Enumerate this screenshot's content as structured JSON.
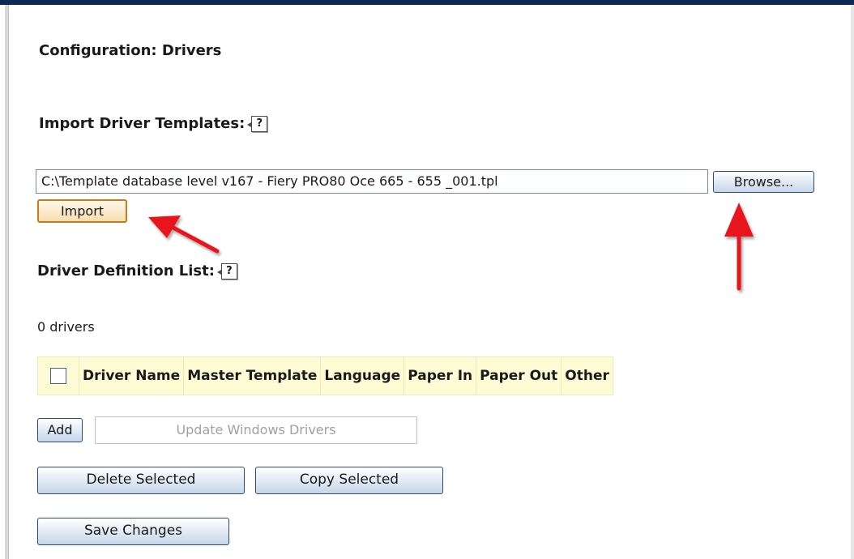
{
  "page": {
    "title": "Configuration: Drivers"
  },
  "import_section": {
    "title": "Import Driver Templates:",
    "help_icon": "help-question-icon",
    "file_path_value": "C:\\Template database level v167 - Fiery PRO80 Oce 665 - 655 _001.tpl",
    "browse_label": "Browse...",
    "import_label": "Import"
  },
  "list_section": {
    "title": "Driver Definition List:",
    "help_icon": "help-question-icon",
    "count_text": "0 drivers",
    "columns": [
      "Driver Name",
      "Master Template",
      "Language",
      "Paper In",
      "Paper Out",
      "Other"
    ]
  },
  "buttons": {
    "add": "Add",
    "update_windows_drivers": "Update Windows Drivers",
    "delete_selected": "Delete Selected",
    "copy_selected": "Copy Selected",
    "save_changes": "Save Changes"
  },
  "colors": {
    "header_bar": "#0b2a55",
    "table_header_bg": "#fffbd4",
    "annotation_arrow": "#e8161b",
    "import_border": "#c97a1a"
  }
}
